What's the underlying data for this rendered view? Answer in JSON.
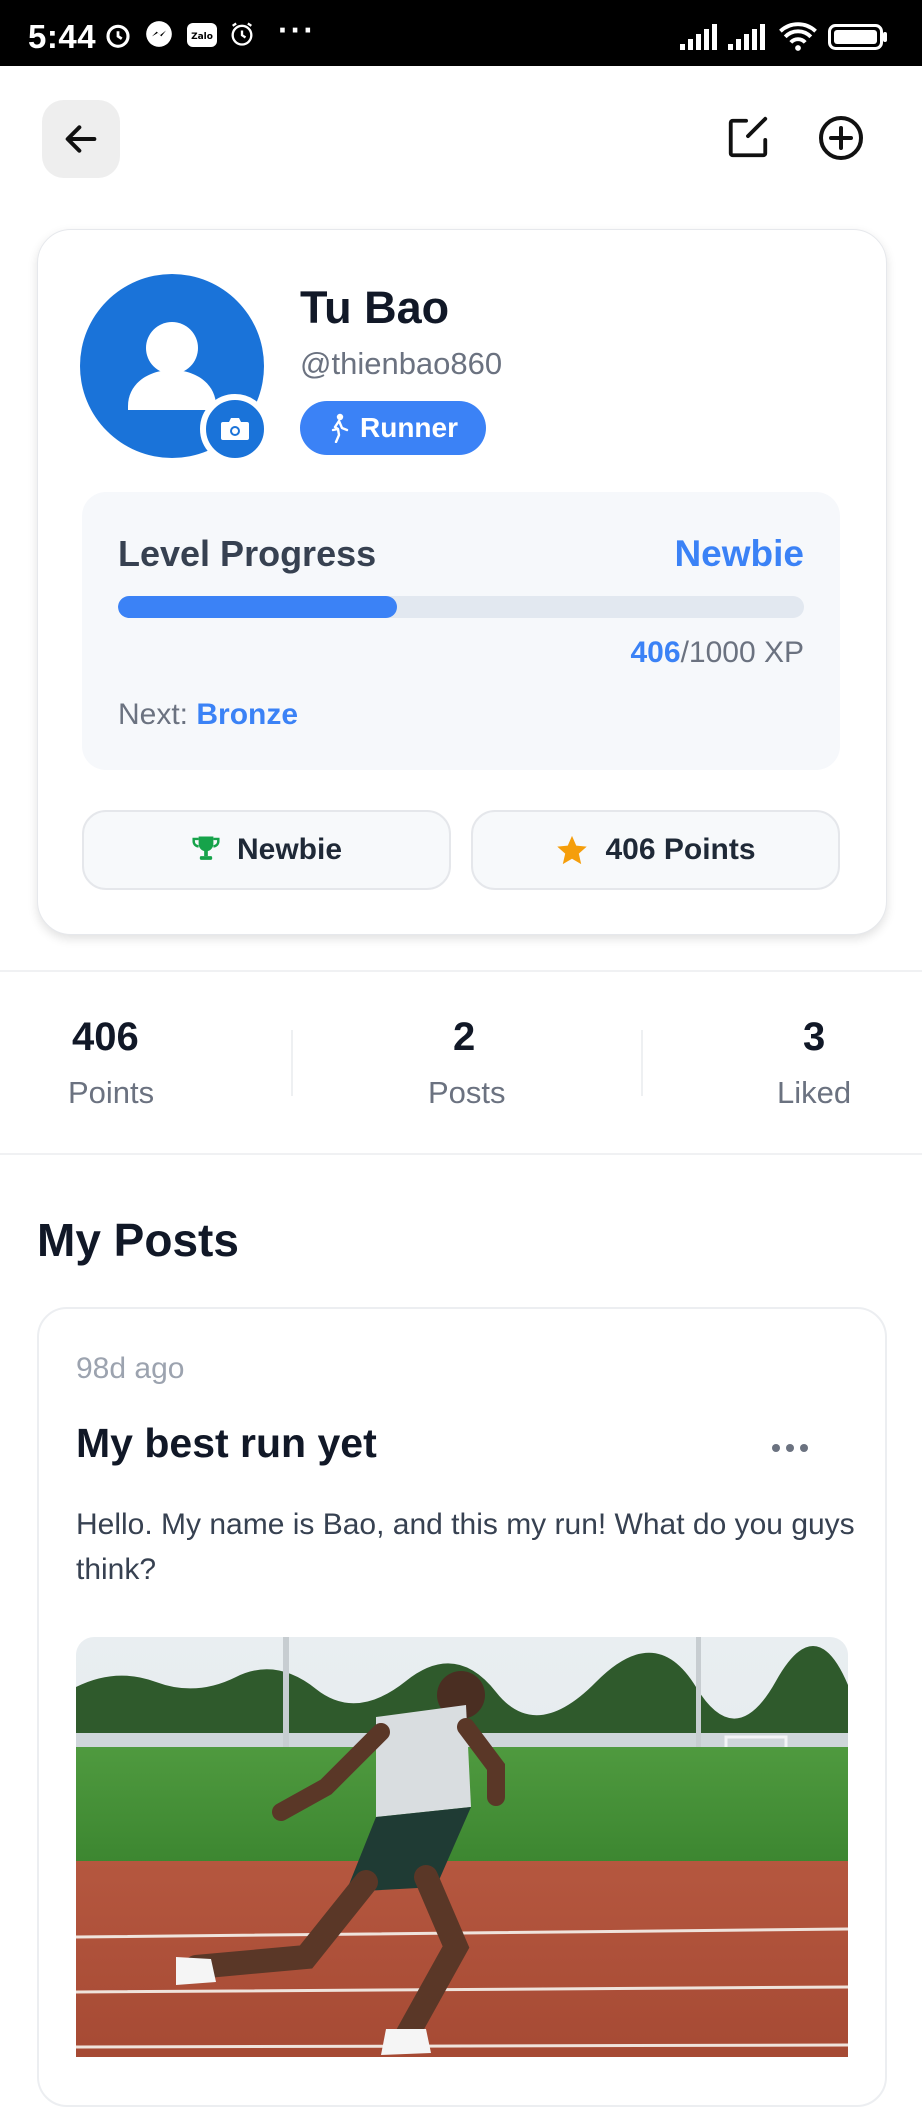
{
  "status_bar": {
    "time": "5:44",
    "more": "···"
  },
  "header": {
    "back_icon": "arrow-left-icon",
    "edit_icon": "edit-square-icon",
    "add_icon": "plus-circle-icon"
  },
  "profile": {
    "name": "Tu Bao",
    "handle": "@thienbao860",
    "role": "Runner",
    "avatar_icon": "user-icon",
    "camera_icon": "camera-icon"
  },
  "level": {
    "title": "Level Progress",
    "rank": "Newbie",
    "xp_current": "406",
    "xp_total": "/1000 XP",
    "progress_fraction": 0.406,
    "next_label": "Next: ",
    "next_rank": "Bronze"
  },
  "chips": [
    {
      "label": "Newbie",
      "icon": "trophy-icon",
      "icon_color": "#16a34a"
    },
    {
      "label": "406 Points",
      "icon": "star-icon",
      "icon_color": "#f59e0b"
    }
  ],
  "stats": [
    {
      "value": "406",
      "label": "Points"
    },
    {
      "value": "2",
      "label": "Posts"
    },
    {
      "value": "3",
      "label": "Liked"
    }
  ],
  "section_title": "My Posts",
  "post": {
    "time": "98d ago",
    "title": "My best run yet",
    "body": "Hello. My name is Bao, and this my run! What do you guys think?",
    "more_icon": "more-horizontal-icon",
    "image_alt": "runner-on-track-photo"
  },
  "colors": {
    "accent": "#3b82f6",
    "avatar_bg": "#1a73d9"
  }
}
